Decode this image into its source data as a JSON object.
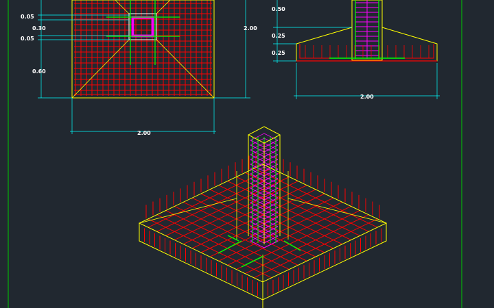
{
  "colors": {
    "background": "#212830",
    "concrete_outline": "#ffff00",
    "rebar": "#ff0000",
    "stirrup": "#ff00ff",
    "main_bar": "#00ff00",
    "dimension": "#00ffff",
    "text": "#ffffff",
    "border": "#00cc00"
  },
  "plan_view": {
    "dim_labels": [
      "0.05",
      "0.30",
      "0.05",
      "0.60",
      "2.00",
      "2.00"
    ]
  },
  "section_view": {
    "dim_labels": [
      "0.50",
      "0.25",
      "0.25",
      "2.00"
    ]
  },
  "isometric_view": {}
}
